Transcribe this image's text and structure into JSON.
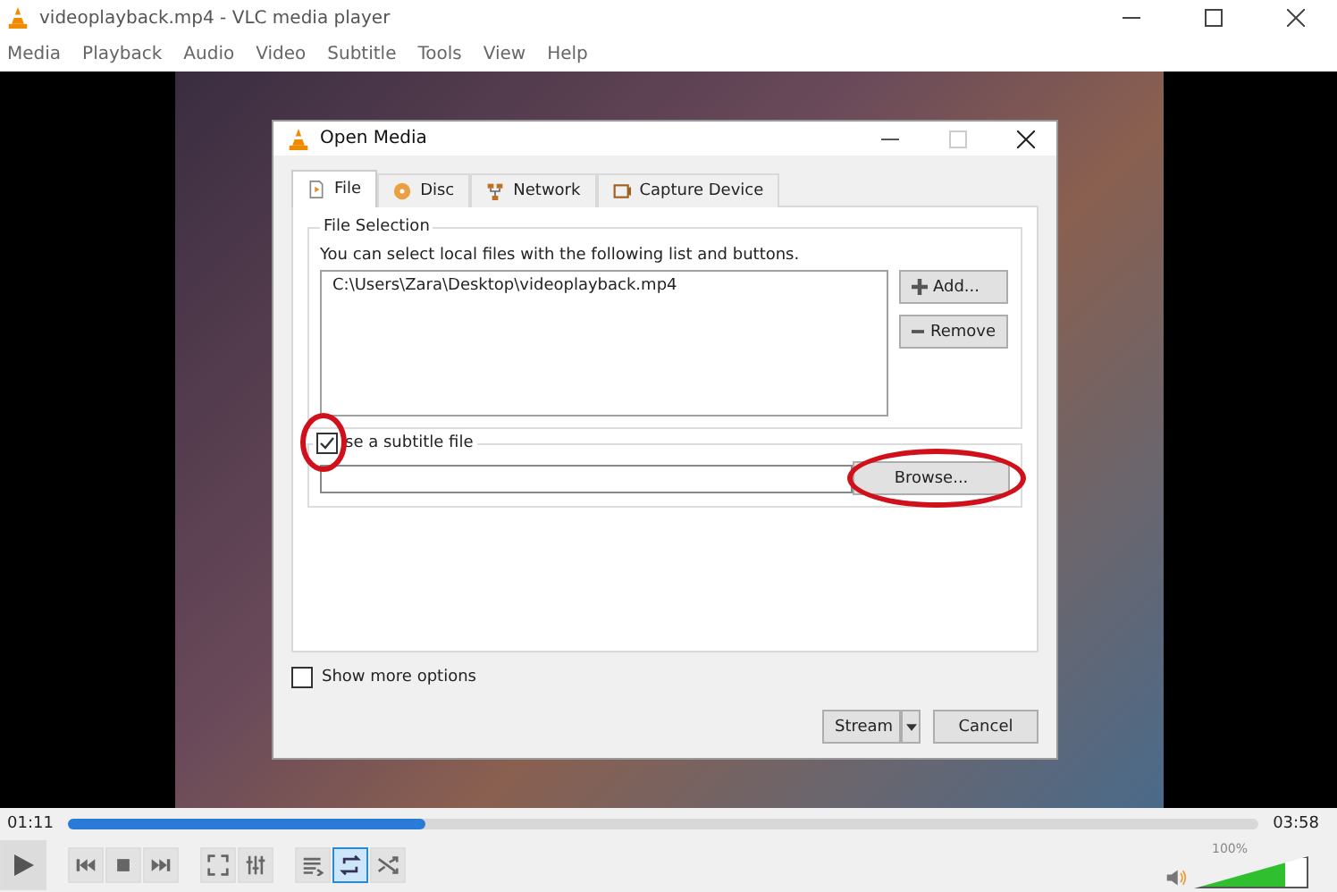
{
  "window": {
    "title": "videoplayback.mp4 - VLC media player"
  },
  "menu": [
    "Media",
    "Playback",
    "Audio",
    "Video",
    "Subtitle",
    "Tools",
    "View",
    "Help"
  ],
  "dialog": {
    "title": "Open Media",
    "tabs": [
      {
        "label": "File",
        "kind": "file",
        "selected": true
      },
      {
        "label": "Disc",
        "kind": "disc",
        "selected": false
      },
      {
        "label": "Network",
        "kind": "network",
        "selected": false
      },
      {
        "label": "Capture Device",
        "kind": "capture",
        "selected": false
      }
    ],
    "file_group": {
      "title": "File Selection",
      "hint": "You can select local files with the following list and buttons.",
      "files": [
        "C:\\Users\\Zara\\Desktop\\videoplayback.mp4"
      ],
      "add_button": "Add...",
      "remove_button": "Remove"
    },
    "subtitle": {
      "label": "se a subtitle file",
      "checked": true,
      "checkbox_circled": true,
      "browse_button": "Browse...",
      "browse_circled": true
    },
    "more_options": {
      "label": "Show more options",
      "checked": false
    },
    "stream_button": "Stream",
    "cancel_button": "Cancel"
  },
  "player": {
    "elapsed": "01:11",
    "total": "03:58",
    "level": 0.3,
    "volume": {
      "reading": "100%",
      "level": 0.8
    },
    "buttons": [
      {
        "kind": "play",
        "on": false
      },
      {
        "kind": "prev",
        "on": false
      },
      {
        "kind": "stop",
        "on": false
      },
      {
        "kind": "next",
        "on": false
      },
      {
        "kind": "fullscreen",
        "on": false
      },
      {
        "kind": "settings",
        "on": false
      },
      {
        "kind": "playlist",
        "on": false
      },
      {
        "kind": "loop",
        "on": true
      },
      {
        "kind": "shuffle",
        "on": false
      }
    ]
  }
}
